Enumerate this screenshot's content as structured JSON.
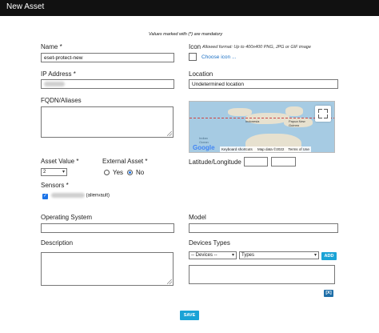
{
  "window": {
    "title": "New Asset"
  },
  "form": {
    "mandatory_note": "Values marked with (*) are mandatory",
    "name": {
      "label": "Name *",
      "value": "eset-protect-new"
    },
    "icon": {
      "label": "Icon",
      "hint": "Allowed format: Up to 400x400 PNG, JPG or GIF image",
      "choose_label": "Choose icon ..."
    },
    "ip_address": {
      "label": "IP Address *"
    },
    "location": {
      "label": "Location",
      "value": "Undetermined location"
    },
    "fqdn": {
      "label": "FQDN/Aliases"
    },
    "map": {
      "labels": {
        "indonesia": "Indonesia",
        "papua": "Papua New Guinea",
        "indian": "Indian",
        "ocean": "Ocean"
      },
      "google": "Google",
      "footer": {
        "shortcuts": "Keyboard shortcuts",
        "mapdata": "Map data ©2022",
        "terms": "Terms of Use"
      }
    },
    "asset_value": {
      "label": "Asset Value *",
      "selected": "2"
    },
    "external_asset": {
      "label": "External Asset *",
      "yes": "Yes",
      "no": "No"
    },
    "latlong": {
      "label": "Latitude/Longitude"
    },
    "sensors": {
      "label": "Sensors *",
      "item_suffix": "(alienvault)"
    },
    "operating_system": {
      "label": "Operating System"
    },
    "model": {
      "label": "Model"
    },
    "description": {
      "label": "Description"
    },
    "devices_types": {
      "label": "Devices Types",
      "devices_select": "-- Devices --",
      "types_select": "Types",
      "add_label": "ADD",
      "remove_label": "[X]"
    },
    "save_label": "SAVE"
  }
}
